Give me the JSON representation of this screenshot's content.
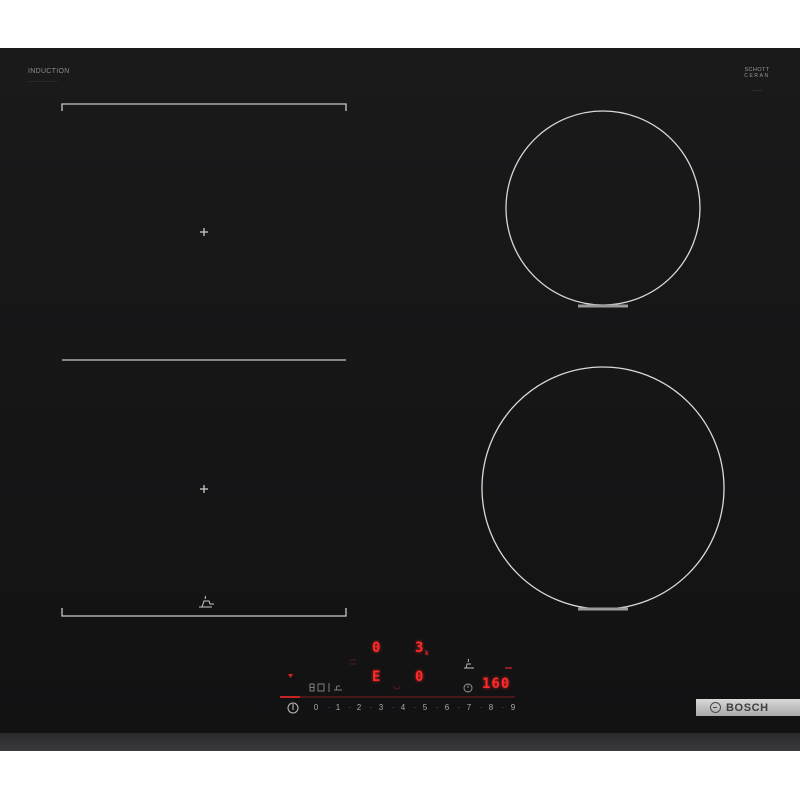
{
  "branding": {
    "induction_label": "INDUCTION",
    "schott_line1": "SCHOTT",
    "schott_line2": "CERAN",
    "manufacturer": "BOSCH"
  },
  "display": {
    "zone_front_left_level": "0",
    "zone_back_right_level": "3",
    "zone_back_right_suffix": "k",
    "zone_front_left_code": "E",
    "zone_front_right_level": "0",
    "timer_value": "160"
  },
  "slider": {
    "levels": [
      "0",
      "1",
      "2",
      "3",
      "4",
      "5",
      "6",
      "7",
      "8",
      "9"
    ]
  },
  "icons": {
    "power": "power-icon",
    "flex_zone": "flex-zone-icon",
    "pan_boost": "pan-icon",
    "timer": "timer-icon",
    "logo": "bosch-armature-icon"
  },
  "colors": {
    "glass": "#161617",
    "zone_markings": "#c9c9c9",
    "display_red": "#ff2a2a",
    "badge_silver": "#c4c4c4"
  }
}
